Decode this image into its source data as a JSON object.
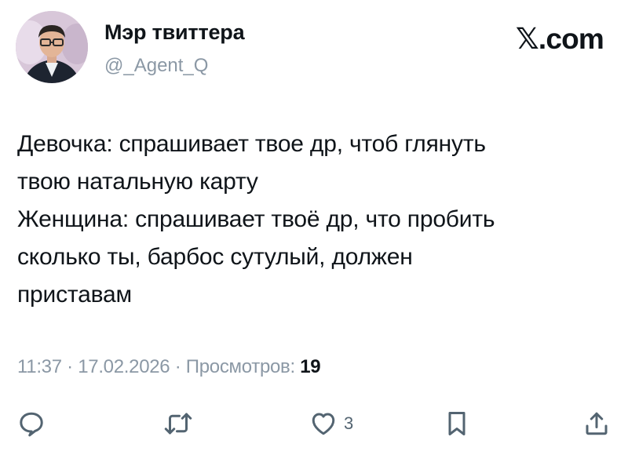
{
  "author": {
    "display_name": "Мэр твиттера",
    "handle": "@_Agent_Q",
    "avatar_icon": "user-photo-avatar"
  },
  "brand": {
    "label": "𝕏.com"
  },
  "tweet": {
    "text": "Девочка: спрашивает твое др, чтоб глянуть\nтвою натальную карту\nЖенщина: спрашивает твоё др, что пробить\nсколько ты, барбос сутулый, должен\nприставам"
  },
  "meta": {
    "time": "11:37",
    "separator": " · ",
    "date": "17.02.2026",
    "views_label": "Просмотров:",
    "views_count": "19"
  },
  "actions": {
    "reply_icon": "comment-bubble-icon",
    "retweet_icon": "retweet-icon",
    "like_icon": "heart-icon",
    "like_count": "3",
    "bookmark_icon": "bookmark-icon",
    "share_icon": "share-icon"
  },
  "colors": {
    "text_primary": "#0f1419",
    "text_secondary": "#8b98a5",
    "icon": "#536471",
    "background": "#ffffff"
  }
}
